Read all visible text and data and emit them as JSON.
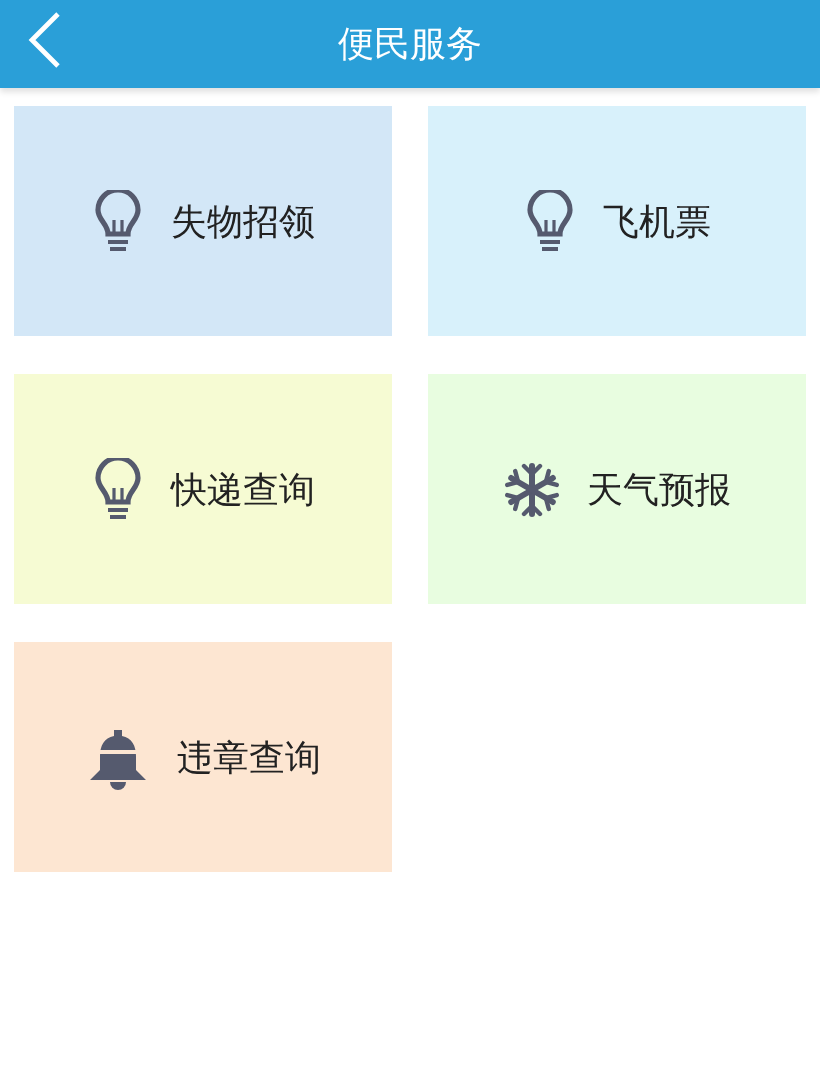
{
  "header": {
    "title": "便民服务"
  },
  "tiles": [
    {
      "label": "失物招领",
      "kind": "bulb",
      "color": "#d3e7f7"
    },
    {
      "label": "飞机票",
      "kind": "bulb",
      "color": "#d8f1fb"
    },
    {
      "label": "快递查询",
      "kind": "bulb",
      "color": "#f6fbd3"
    },
    {
      "label": "天气预报",
      "kind": "snowflake",
      "color": "#e8fde0"
    },
    {
      "label": "违章查询",
      "kind": "bell",
      "color": "#fde6d2"
    }
  ]
}
